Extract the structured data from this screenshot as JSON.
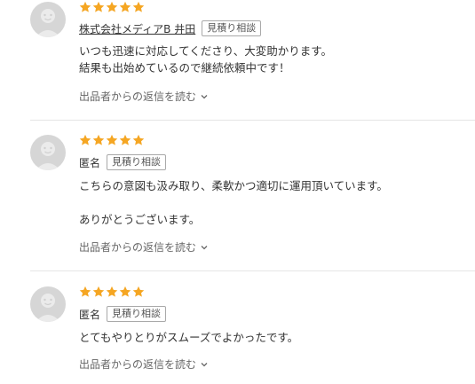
{
  "reviews": [
    {
      "rating": 5,
      "reviewer": "株式会社メディアB 井田",
      "badge": "見積り相談",
      "body": "いつも迅速に対応してくださり、大変助かります。\n結果も出始めているので継続依頼中です！",
      "reply_link": "出品者からの返信を読む"
    },
    {
      "rating": 5,
      "reviewer": "匿名",
      "badge": "見積り相談",
      "body": "こちらの意図も汲み取り、柔軟かつ適切に運用頂いています。\n\nありがとうございます。",
      "reply_link": "出品者からの返信を読む"
    },
    {
      "rating": 5,
      "reviewer": "匿名",
      "badge": "見積り相談",
      "body": "とてもやりとりがスムーズでよかったです。",
      "reply_link": "出品者からの返信を読む"
    }
  ],
  "colors": {
    "star": "#f5a623",
    "avatar": "#d6d6d6",
    "divider": "#e5e5e5"
  },
  "icons": {
    "star": "star-icon",
    "avatar": "user-avatar-icon",
    "reply_chevron": "chevron-down-icon"
  }
}
